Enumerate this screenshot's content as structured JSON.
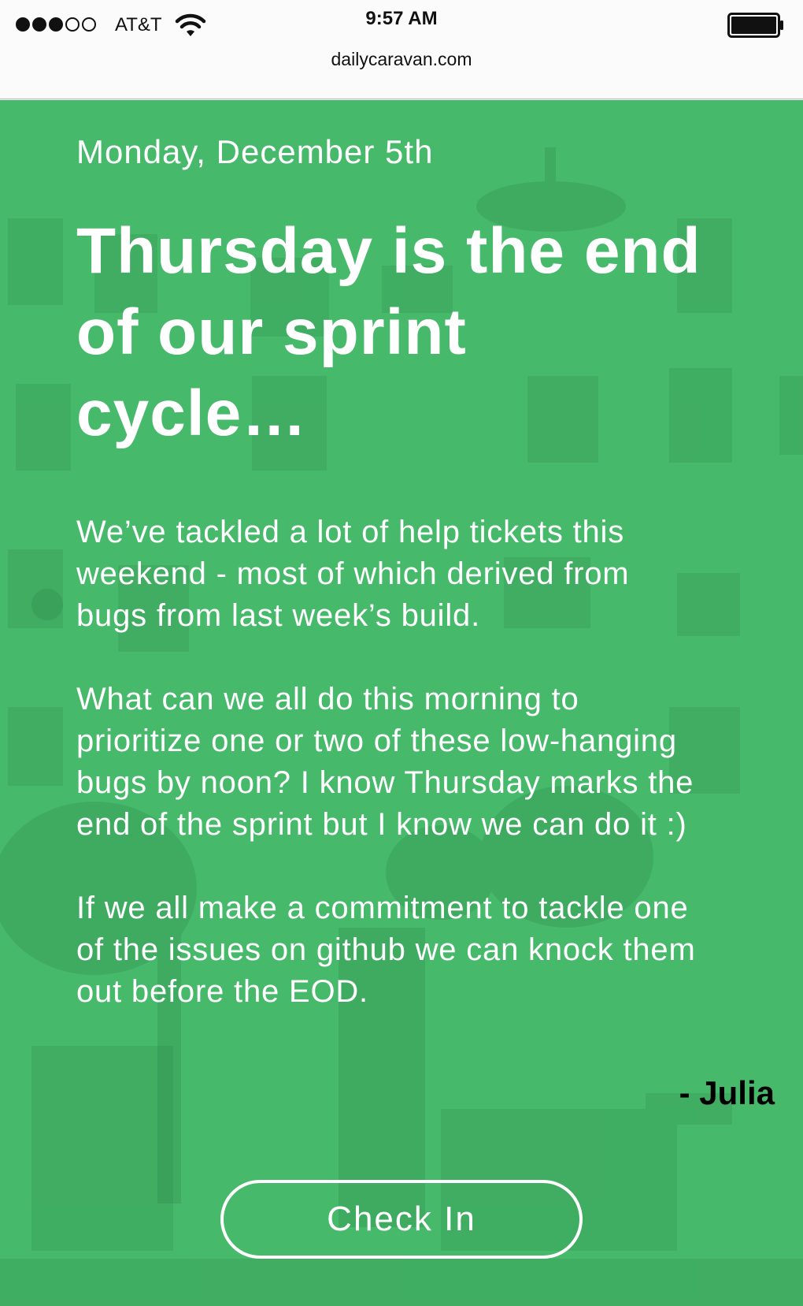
{
  "status_bar": {
    "signal_bars_filled": 3,
    "signal_bars_total": 5,
    "carrier": "AT&T",
    "wifi_icon": "wifi-icon",
    "time": "9:57 AM",
    "url": "dailycaravan.com",
    "battery_icon": "battery-full-icon"
  },
  "page": {
    "date": "Monday, December 5th",
    "headline": "Thursday is the end of our sprint cycle…",
    "paragraphs": [
      "We’ve tackled a lot of help tickets this weekend - most of which derived from bugs from last week’s build.",
      "What can we all do this morning to prioritize one or two of these low-hanging bugs by noon? I know Thursday marks the end of the sprint but I know we can do it :)",
      "If we all make a commitment to tackle one of the issues on github we can knock them out before the EOD."
    ],
    "signature": "- Julia",
    "button_label": "Check In"
  },
  "colors": {
    "hero_green": "#47b96b",
    "text": "#ffffff",
    "status_bar_bg": "#fbfbfb"
  }
}
